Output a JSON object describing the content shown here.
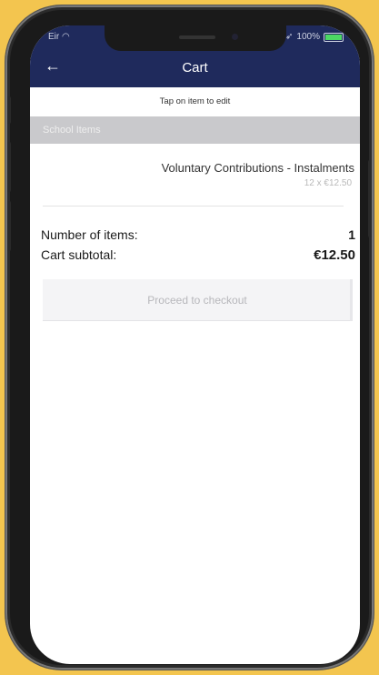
{
  "status_bar": {
    "carrier": "Eir",
    "battery": "100%"
  },
  "header": {
    "back_label": "←",
    "title": "Cart"
  },
  "hint": "Tap on item to edit",
  "section": {
    "label": "School Items"
  },
  "item": {
    "name": "Voluntary Contributions - Instalments",
    "detail": "12 x €12.50"
  },
  "totals": {
    "items_label": "Number of items:",
    "items_value": "1",
    "subtotal_label": "Cart subtotal:",
    "subtotal_value": "€12.50"
  },
  "checkout": {
    "label": "Proceed to checkout"
  },
  "colors": {
    "header_bg": "#1F2A5C",
    "section_bg": "#C9C9CC",
    "background": "#F3C54F"
  }
}
